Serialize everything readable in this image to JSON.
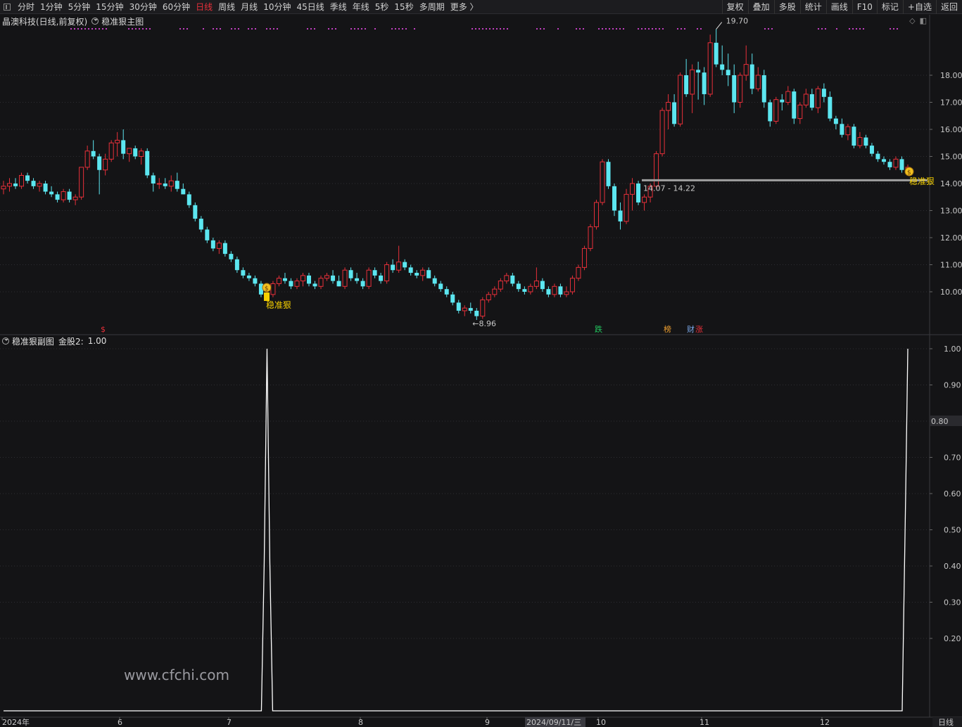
{
  "toolbar": {
    "periods": [
      "分时",
      "1分钟",
      "5分钟",
      "15分钟",
      "30分钟",
      "60分钟",
      "日线",
      "周线",
      "月线",
      "10分钟",
      "45日线",
      "季线",
      "年线",
      "5秒",
      "15秒",
      "多周期",
      "更多 〉"
    ],
    "active_period": "日线",
    "right_buttons": [
      "复权",
      "叠加",
      "多股",
      "统计",
      "画线",
      "F10",
      "标记",
      "+自选",
      "返回"
    ]
  },
  "main_panel": {
    "stock_label": "晶澳科技(日线,前复权)",
    "indicator_name": "稳准狠主图",
    "high_marker": "19.70",
    "low_marker": "8.96",
    "support_label": "14.07 - 14.22",
    "signal_label": "稳准狠",
    "signal_label_right": "稳准狠",
    "event_tags": [
      {
        "text": "$",
        "color": "#e8303a"
      },
      {
        "text": "跌",
        "color": "#22c55e"
      },
      {
        "text": "榜",
        "color": "#f0a030"
      },
      {
        "text": "财",
        "color": "#7aa8e8"
      },
      {
        "text": "涨",
        "color": "#e8303a"
      }
    ],
    "price_axis": [
      "18.00",
      "17.00",
      "16.00",
      "15.00",
      "14.00",
      "13.00",
      "12.00",
      "11.00",
      "10.00"
    ],
    "colors": {
      "up": "#e8303a",
      "down": "#5ce6f0",
      "signal_dots": "#c040c0",
      "support_line": "#a0a0a0"
    }
  },
  "sub_panel": {
    "indicator_name": "稳准狠副图",
    "series_label": "金股2:",
    "series_value": "1.00",
    "value_axis": [
      "1.00",
      "0.90",
      "0.80",
      "0.70",
      "0.60",
      "0.50",
      "0.40",
      "0.30",
      "0.20"
    ],
    "crosshair_value": "0.80"
  },
  "date_axis": {
    "labels": [
      "2024年",
      "6",
      "7",
      "8",
      "9",
      "10",
      "11",
      "12"
    ],
    "cursor_date": "2024/09/11/三",
    "period_label": "日线"
  },
  "watermark": "www.cfchi.com",
  "chart_data": {
    "type": "candlestick",
    "title": "晶澳科技(日线,前复权)",
    "y_range": [
      8.96,
      19.7
    ],
    "ohlc": [
      [
        13.8,
        14.1,
        13.6,
        13.9
      ],
      [
        13.9,
        14.2,
        13.7,
        14.0
      ],
      [
        14.0,
        14.2,
        13.8,
        13.9
      ],
      [
        13.9,
        14.4,
        13.8,
        14.3
      ],
      [
        14.3,
        14.4,
        14.0,
        14.1
      ],
      [
        14.1,
        14.2,
        13.8,
        13.9
      ],
      [
        13.9,
        14.1,
        13.7,
        14.0
      ],
      [
        14.0,
        14.1,
        13.6,
        13.7
      ],
      [
        13.7,
        13.9,
        13.5,
        13.6
      ],
      [
        13.6,
        13.7,
        13.3,
        13.4
      ],
      [
        13.4,
        13.8,
        13.3,
        13.7
      ],
      [
        13.7,
        13.8,
        13.3,
        13.4
      ],
      [
        13.4,
        13.6,
        13.2,
        13.5
      ],
      [
        13.5,
        14.6,
        13.4,
        14.6
      ],
      [
        14.6,
        15.4,
        14.5,
        15.2
      ],
      [
        15.2,
        15.6,
        14.9,
        15.0
      ],
      [
        15.0,
        15.1,
        13.6,
        14.5
      ],
      [
        14.5,
        15.1,
        14.3,
        14.9
      ],
      [
        14.9,
        15.6,
        14.8,
        15.5
      ],
      [
        15.5,
        15.9,
        15.0,
        15.6
      ],
      [
        15.6,
        16.0,
        14.9,
        15.1
      ],
      [
        15.1,
        15.3,
        14.8,
        15.3
      ],
      [
        15.3,
        15.4,
        14.9,
        15.0
      ],
      [
        15.0,
        15.3,
        14.7,
        15.2
      ],
      [
        15.2,
        15.3,
        14.2,
        14.3
      ],
      [
        14.3,
        14.4,
        13.7,
        14.0
      ],
      [
        14.0,
        14.2,
        13.8,
        14.0
      ],
      [
        14.0,
        14.2,
        13.8,
        13.9
      ],
      [
        13.9,
        14.3,
        13.7,
        14.1
      ],
      [
        14.1,
        14.4,
        13.7,
        13.8
      ],
      [
        13.8,
        14.0,
        13.6,
        13.6
      ],
      [
        13.6,
        13.7,
        13.1,
        13.2
      ],
      [
        13.2,
        13.3,
        12.6,
        12.7
      ],
      [
        12.7,
        12.8,
        12.2,
        12.3
      ],
      [
        12.3,
        12.4,
        11.8,
        11.9
      ],
      [
        11.9,
        12.0,
        11.5,
        11.6
      ],
      [
        11.6,
        11.9,
        11.4,
        11.8
      ],
      [
        11.8,
        11.9,
        11.3,
        11.4
      ],
      [
        11.4,
        11.5,
        11.1,
        11.2
      ],
      [
        11.2,
        11.3,
        10.7,
        10.8
      ],
      [
        10.8,
        10.9,
        10.5,
        10.6
      ],
      [
        10.6,
        10.7,
        10.4,
        10.5
      ],
      [
        10.5,
        10.6,
        10.2,
        10.3
      ],
      [
        10.3,
        10.4,
        9.8,
        9.9
      ],
      [
        9.9,
        10.0,
        9.7,
        9.9
      ],
      [
        9.9,
        10.4,
        9.8,
        10.3
      ],
      [
        10.3,
        10.6,
        10.2,
        10.5
      ],
      [
        10.5,
        10.7,
        10.3,
        10.4
      ],
      [
        10.4,
        10.5,
        10.1,
        10.2
      ],
      [
        10.2,
        10.5,
        10.1,
        10.4
      ],
      [
        10.4,
        10.7,
        10.2,
        10.6
      ],
      [
        10.6,
        10.7,
        10.2,
        10.3
      ],
      [
        10.3,
        10.4,
        10.1,
        10.2
      ],
      [
        10.2,
        10.6,
        10.1,
        10.5
      ],
      [
        10.5,
        10.7,
        10.4,
        10.6
      ],
      [
        10.6,
        10.8,
        10.3,
        10.4
      ],
      [
        10.4,
        10.6,
        10.2,
        10.2
      ],
      [
        10.2,
        10.9,
        10.1,
        10.8
      ],
      [
        10.8,
        10.9,
        10.4,
        10.5
      ],
      [
        10.5,
        10.7,
        10.3,
        10.4
      ],
      [
        10.4,
        10.5,
        10.1,
        10.2
      ],
      [
        10.2,
        10.9,
        10.1,
        10.8
      ],
      [
        10.8,
        10.9,
        10.5,
        10.6
      ],
      [
        10.6,
        10.7,
        10.3,
        10.4
      ],
      [
        10.4,
        11.1,
        10.3,
        11.0
      ],
      [
        11.0,
        11.2,
        10.7,
        10.8
      ],
      [
        10.8,
        11.7,
        10.7,
        11.1
      ],
      [
        11.1,
        11.2,
        10.8,
        10.9
      ],
      [
        10.9,
        11.0,
        10.6,
        10.7
      ],
      [
        10.7,
        10.8,
        10.5,
        10.6
      ],
      [
        10.6,
        10.9,
        10.4,
        10.8
      ],
      [
        10.8,
        10.9,
        10.5,
        10.5
      ],
      [
        10.5,
        10.6,
        10.2,
        10.3
      ],
      [
        10.3,
        10.4,
        10.0,
        10.1
      ],
      [
        10.1,
        10.2,
        9.8,
        9.9
      ],
      [
        9.9,
        10.0,
        9.5,
        9.6
      ],
      [
        9.6,
        9.7,
        9.2,
        9.3
      ],
      [
        9.3,
        9.5,
        9.1,
        9.4
      ],
      [
        9.4,
        9.6,
        9.2,
        9.3
      ],
      [
        9.3,
        9.4,
        8.96,
        9.1
      ],
      [
        9.1,
        9.8,
        9.0,
        9.7
      ],
      [
        9.7,
        10.0,
        9.6,
        9.9
      ],
      [
        9.9,
        10.2,
        9.8,
        10.1
      ],
      [
        10.1,
        10.5,
        10.0,
        10.4
      ],
      [
        10.4,
        10.7,
        10.3,
        10.6
      ],
      [
        10.6,
        10.7,
        10.2,
        10.3
      ],
      [
        10.3,
        10.4,
        10.0,
        10.1
      ],
      [
        10.1,
        10.2,
        9.9,
        10.0
      ],
      [
        10.0,
        10.3,
        9.9,
        10.2
      ],
      [
        10.2,
        10.9,
        10.1,
        10.4
      ],
      [
        10.4,
        10.5,
        10.0,
        10.1
      ],
      [
        10.1,
        10.2,
        9.8,
        9.9
      ],
      [
        9.9,
        10.3,
        9.8,
        10.2
      ],
      [
        10.2,
        10.3,
        9.8,
        9.9
      ],
      [
        9.9,
        10.2,
        9.8,
        10.0
      ],
      [
        10.0,
        10.6,
        9.9,
        10.5
      ],
      [
        10.5,
        11.0,
        10.4,
        10.9
      ],
      [
        10.9,
        11.7,
        10.8,
        11.6
      ],
      [
        11.6,
        12.5,
        11.5,
        12.4
      ],
      [
        12.4,
        13.4,
        12.3,
        13.3
      ],
      [
        13.3,
        14.9,
        13.2,
        14.8
      ],
      [
        14.8,
        14.9,
        13.8,
        13.9
      ],
      [
        13.9,
        14.0,
        12.8,
        13.0
      ],
      [
        13.0,
        13.3,
        12.3,
        12.6
      ],
      [
        12.6,
        13.8,
        12.5,
        13.6
      ],
      [
        13.6,
        14.2,
        13.0,
        14.0
      ],
      [
        14.0,
        14.1,
        13.2,
        13.3
      ],
      [
        13.3,
        13.6,
        13.0,
        13.5
      ],
      [
        13.5,
        14.0,
        13.3,
        13.9
      ],
      [
        13.9,
        15.2,
        13.8,
        15.1
      ],
      [
        15.1,
        16.8,
        15.0,
        16.7
      ],
      [
        16.7,
        17.3,
        16.0,
        17.0
      ],
      [
        17.0,
        17.3,
        16.1,
        16.2
      ],
      [
        16.2,
        18.1,
        16.1,
        18.0
      ],
      [
        18.0,
        18.6,
        17.2,
        17.3
      ],
      [
        17.3,
        18.4,
        16.6,
        18.2
      ],
      [
        18.2,
        18.5,
        17.1,
        18.1
      ],
      [
        18.1,
        18.3,
        16.9,
        17.3
      ],
      [
        17.3,
        19.5,
        17.2,
        19.2
      ],
      [
        19.2,
        19.7,
        18.3,
        18.4
      ],
      [
        18.4,
        19.1,
        18.0,
        18.2
      ],
      [
        18.2,
        18.8,
        17.6,
        18.0
      ],
      [
        18.0,
        18.4,
        16.6,
        17.0
      ],
      [
        17.0,
        18.1,
        16.8,
        18.0
      ],
      [
        18.0,
        19.1,
        17.8,
        18.4
      ],
      [
        18.4,
        18.8,
        17.3,
        17.5
      ],
      [
        17.5,
        18.3,
        17.4,
        18.0
      ],
      [
        18.0,
        18.2,
        16.8,
        17.0
      ],
      [
        17.0,
        17.1,
        16.1,
        16.3
      ],
      [
        16.3,
        17.2,
        16.2,
        17.1
      ],
      [
        17.1,
        17.3,
        16.7,
        17.0
      ],
      [
        17.0,
        17.6,
        16.9,
        17.4
      ],
      [
        17.4,
        17.5,
        16.2,
        16.4
      ],
      [
        16.4,
        17.0,
        16.2,
        16.9
      ],
      [
        16.9,
        17.5,
        16.8,
        17.3
      ],
      [
        17.3,
        17.5,
        16.7,
        16.8
      ],
      [
        16.8,
        17.6,
        16.6,
        17.5
      ],
      [
        17.5,
        17.7,
        17.0,
        17.2
      ],
      [
        17.2,
        17.4,
        16.3,
        16.4
      ],
      [
        16.4,
        16.5,
        16.0,
        16.2
      ],
      [
        16.2,
        16.4,
        15.7,
        15.8
      ],
      [
        15.8,
        16.2,
        15.6,
        16.1
      ],
      [
        16.1,
        16.2,
        15.3,
        15.4
      ],
      [
        15.4,
        15.9,
        15.3,
        15.7
      ],
      [
        15.7,
        15.8,
        15.3,
        15.4
      ],
      [
        15.4,
        15.5,
        15.0,
        15.1
      ],
      [
        15.1,
        15.2,
        14.8,
        14.9
      ],
      [
        14.9,
        15.0,
        14.7,
        14.8
      ],
      [
        14.8,
        14.9,
        14.5,
        14.6
      ],
      [
        14.6,
        15.0,
        14.5,
        14.9
      ],
      [
        14.9,
        15.0,
        14.4,
        14.5
      ],
      [
        14.5,
        14.7,
        14.3,
        14.6
      ]
    ],
    "sub_series": {
      "name": "金股2",
      "signal_days": [
        44,
        151
      ],
      "signal_value": 1.0,
      "baseline": 0.0
    }
  }
}
